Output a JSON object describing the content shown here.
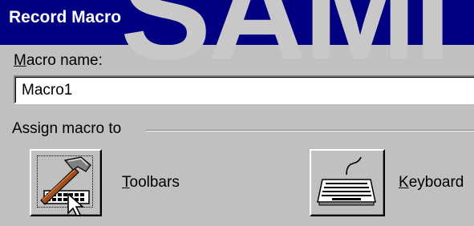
{
  "window": {
    "title": "Record Macro"
  },
  "watermark": {
    "text": "SAMI"
  },
  "macro_name": {
    "label_mnemonic": "M",
    "label_rest": "acro name:",
    "value": "Macro1"
  },
  "assign": {
    "group_label": "Assign macro to",
    "toolbars_mnemonic": "T",
    "toolbars_rest": "oolbars",
    "keyboard_mnemonic": "K",
    "keyboard_rest": "eyboard"
  },
  "icons": {
    "toolbars": "hammer-toolbar-icon",
    "keyboard": "keyboard-icon",
    "cursor": "mouse-pointer-icon"
  },
  "colors": {
    "titlebar": "#000080",
    "dialog": "#c0c0c0"
  }
}
